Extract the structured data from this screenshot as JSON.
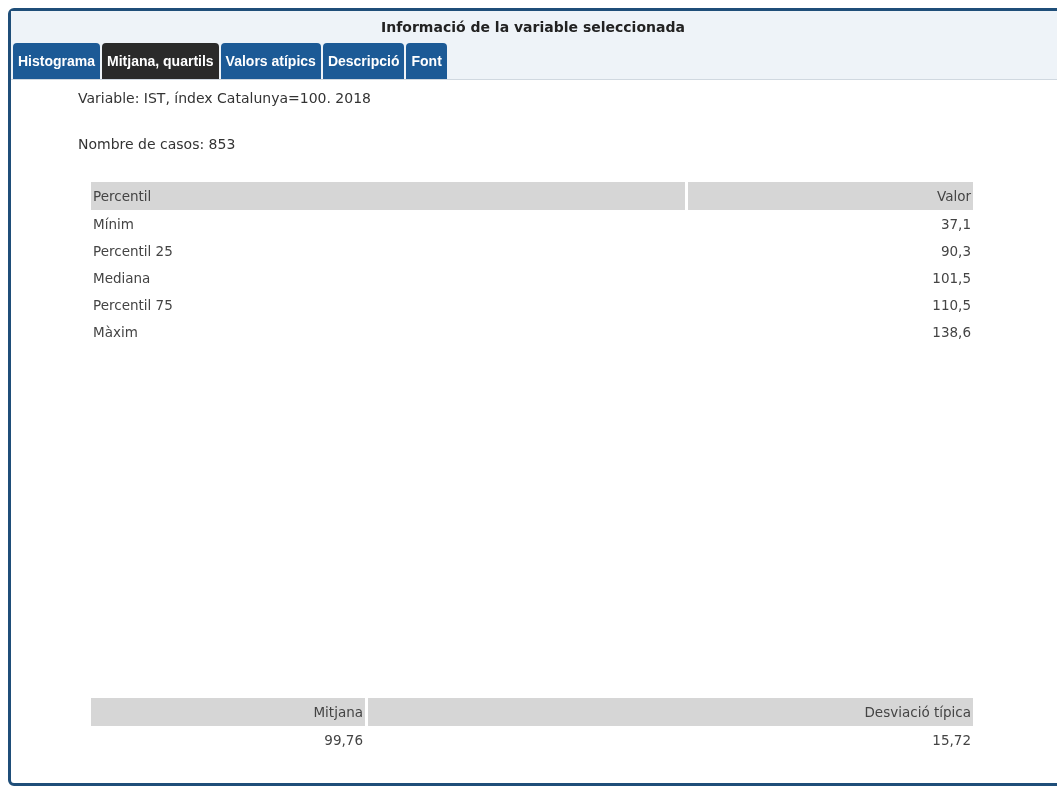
{
  "window": {
    "title": "Informació de la variable seleccionada"
  },
  "tabs": [
    {
      "label": "Histograma",
      "selected": false
    },
    {
      "label": "Mitjana, quartils",
      "selected": true
    },
    {
      "label": "Valors atípics",
      "selected": false
    },
    {
      "label": "Descripció",
      "selected": false
    },
    {
      "label": "Font",
      "selected": false
    }
  ],
  "variable": "Variable: IST, índex Catalunya=100. 2018",
  "cases": "Nombre de casos: 853",
  "percentiles": {
    "columns": [
      "Percentil",
      "Valor"
    ],
    "rows": [
      [
        "Mínim",
        "37,1"
      ],
      [
        "Percentil 25",
        "90,3"
      ],
      [
        "Mediana",
        "101,5"
      ],
      [
        "Percentil 75",
        "110,5"
      ],
      [
        "Màxim",
        "138,6"
      ]
    ]
  },
  "summary": {
    "columns": [
      "Mitjana",
      "Desviació típica"
    ],
    "rows": [
      [
        "99,76",
        "15,72"
      ]
    ]
  }
}
